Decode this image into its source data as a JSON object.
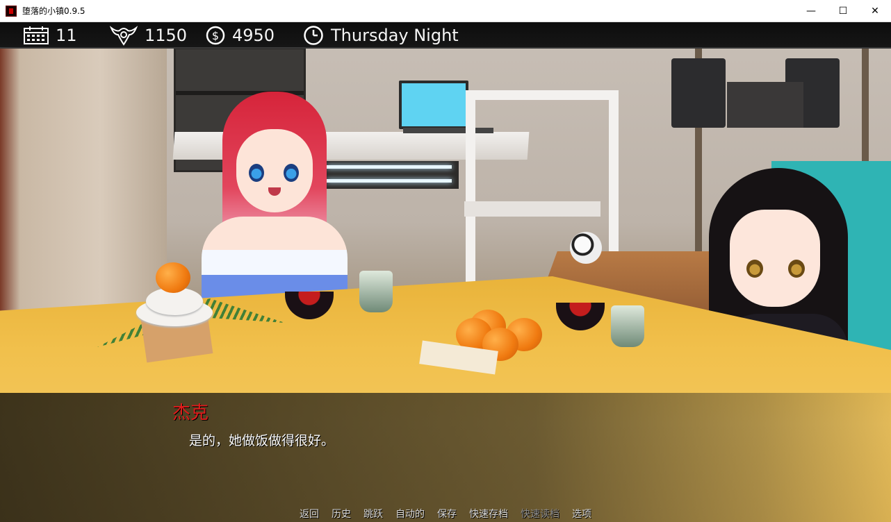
{
  "window": {
    "title": "堕落的小镇0.9.5",
    "controls": {
      "minimize": "—",
      "maximize": "☐",
      "close": "✕"
    }
  },
  "hud": {
    "day": {
      "icon": "calendar-icon",
      "value": "11"
    },
    "corruption": {
      "icon": "demon-emblem-icon",
      "value": "1150"
    },
    "money": {
      "icon": "dollar-coin-icon",
      "value": "4950"
    },
    "time": {
      "icon": "clock-icon",
      "value": "Thursday Night"
    }
  },
  "dialogue": {
    "speaker": "杰克",
    "text": "是的，她做饭做得很好。",
    "speaker_color": "#e01b1b"
  },
  "quick_menu": [
    {
      "label": "返回",
      "enabled": true
    },
    {
      "label": "历史",
      "enabled": true
    },
    {
      "label": "跳跃",
      "enabled": true
    },
    {
      "label": "自动的",
      "enabled": true
    },
    {
      "label": "保存",
      "enabled": true
    },
    {
      "label": "快速存档",
      "enabled": true
    },
    {
      "label": "快速读档",
      "enabled": false
    },
    {
      "label": "选项",
      "enabled": true
    }
  ]
}
